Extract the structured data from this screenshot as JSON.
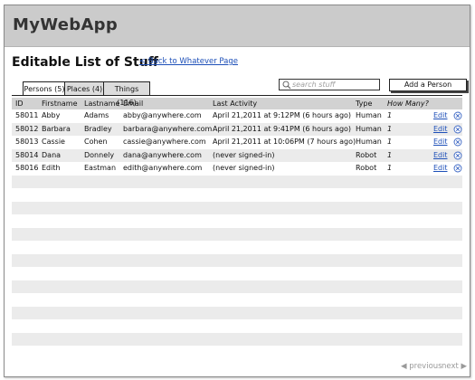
{
  "app": {
    "title": "MyWebApp"
  },
  "page": {
    "title": "Editable List of Stuff",
    "back_link": "< Back to Whatever Page"
  },
  "tabs": [
    {
      "label": "Persons (5)",
      "active": true
    },
    {
      "label": "Places (4)",
      "active": false
    },
    {
      "label": "Things (116)",
      "active": false
    }
  ],
  "search": {
    "placeholder": "search stuff",
    "icon": "search-icon"
  },
  "add_button": {
    "label": "Add a Person"
  },
  "table": {
    "columns": [
      "ID",
      "Firstname",
      "Lastname",
      "Email",
      "Last Activity",
      "Type",
      "How Many?"
    ],
    "rows": [
      {
        "id": "58011",
        "first": "Abby",
        "last": "Adams",
        "email": "abby@anywhere.com",
        "activity": "April 21,2011 at 9:12PM (6 hours ago)",
        "type": "Human",
        "many": "1",
        "edit": "Edit"
      },
      {
        "id": "58012",
        "first": "Barbara",
        "last": "Bradley",
        "email": "barbara@anywhere.com",
        "activity": "April 21,2011 at 9:41PM (6 hours ago)",
        "type": "Human",
        "many": "1",
        "edit": "Edit"
      },
      {
        "id": "58013",
        "first": "Cassie",
        "last": "Cohen",
        "email": "cassie@anywhere.com",
        "activity": "April 21,2011 at 10:06PM (7 hours ago)",
        "type": "Human",
        "many": "1",
        "edit": "Edit"
      },
      {
        "id": "58014",
        "first": "Dana",
        "last": "Donnely",
        "email": "dana@anywhere.com",
        "activity": "(never signed-in)",
        "type": "Robot",
        "many": "1",
        "edit": "Edit"
      },
      {
        "id": "58016",
        "first": "Edith",
        "last": "Eastman",
        "email": "edith@anywhere.com",
        "activity": "(never signed-in)",
        "type": "Robot",
        "many": "1",
        "edit": "Edit"
      }
    ],
    "empty_rows": 14
  },
  "pager": {
    "previous": "previous",
    "next": "next"
  }
}
